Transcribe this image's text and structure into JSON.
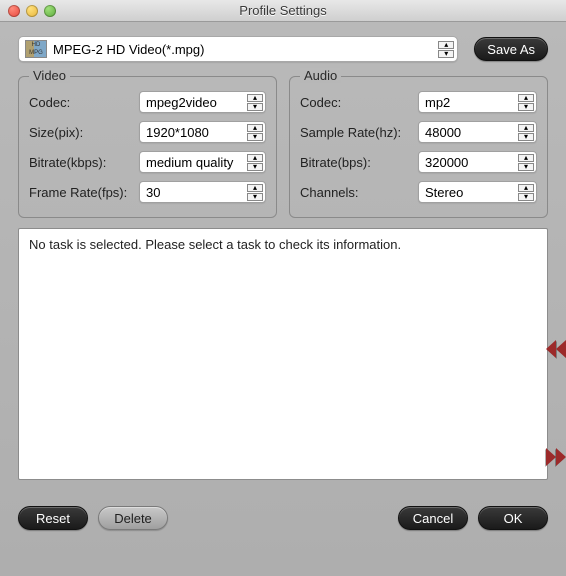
{
  "window": {
    "title": "Profile Settings"
  },
  "topbar": {
    "profile": "MPEG-2 HD Video(*.mpg)",
    "icon_t": "HD",
    "icon_b": "MPG",
    "save_as": "Save As"
  },
  "video": {
    "legend": "Video",
    "codec_label": "Codec:",
    "codec_value": "mpeg2video",
    "size_label": "Size(pix):",
    "size_value": "1920*1080",
    "bitrate_label": "Bitrate(kbps):",
    "bitrate_value": "medium quality",
    "fps_label": "Frame Rate(fps):",
    "fps_value": "30"
  },
  "audio": {
    "legend": "Audio",
    "codec_label": "Codec:",
    "codec_value": "mp2",
    "rate_label": "Sample Rate(hz):",
    "rate_value": "48000",
    "bitrate_label": "Bitrate(bps):",
    "bitrate_value": "320000",
    "channels_label": "Channels:",
    "channels_value": "Stereo"
  },
  "info": {
    "text": "No task is selected. Please select a task to check its information."
  },
  "footer": {
    "reset": "Reset",
    "delete": "Delete",
    "cancel": "Cancel",
    "ok": "OK"
  }
}
